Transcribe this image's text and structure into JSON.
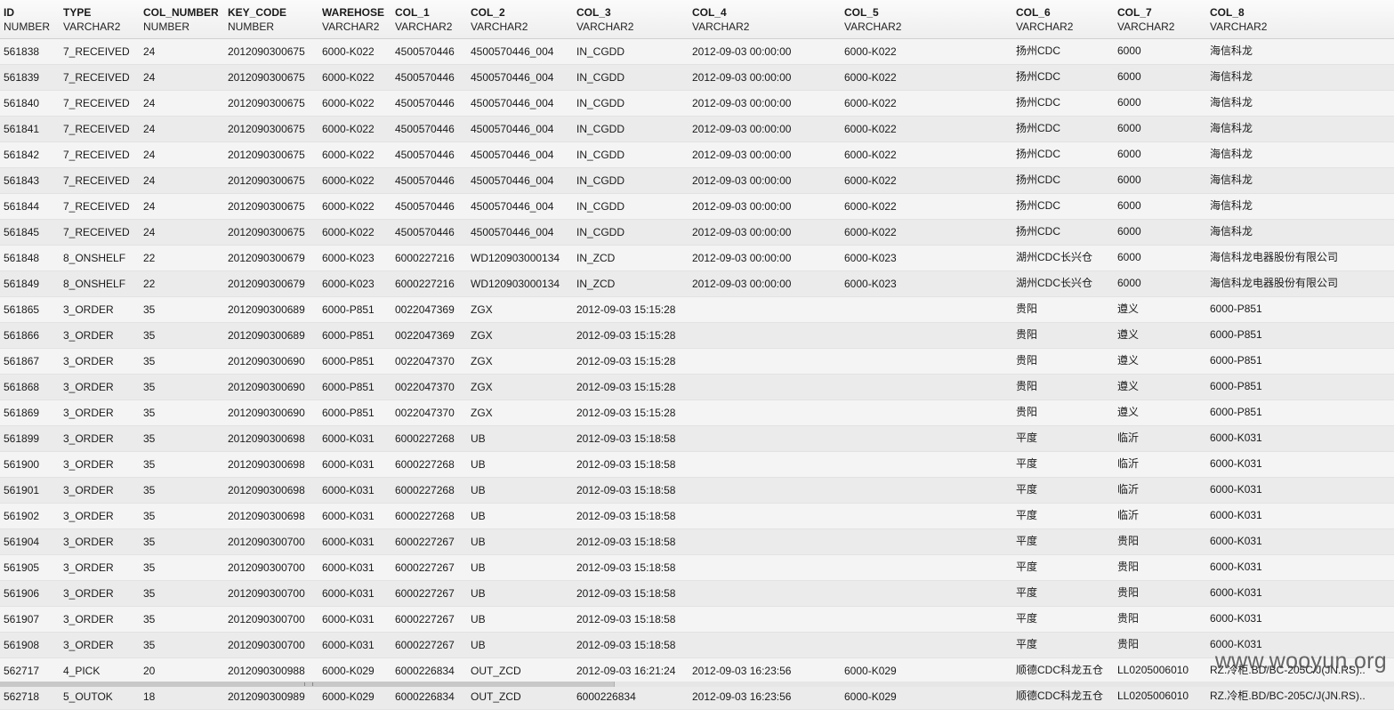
{
  "columns": [
    {
      "name": "ID",
      "type": "NUMBER"
    },
    {
      "name": "TYPE",
      "type": "VARCHAR2"
    },
    {
      "name": "COL_NUMBER",
      "type": "NUMBER"
    },
    {
      "name": "KEY_CODE",
      "type": "NUMBER"
    },
    {
      "name": "WAREHOSE",
      "type": "VARCHAR2"
    },
    {
      "name": "COL_1",
      "type": "VARCHAR2"
    },
    {
      "name": "COL_2",
      "type": "VARCHAR2"
    },
    {
      "name": "COL_3",
      "type": "VARCHAR2"
    },
    {
      "name": "COL_4",
      "type": "VARCHAR2"
    },
    {
      "name": "COL_5",
      "type": "VARCHAR2"
    },
    {
      "name": "COL_6",
      "type": "VARCHAR2"
    },
    {
      "name": "COL_7",
      "type": "VARCHAR2"
    },
    {
      "name": "COL_8",
      "type": "VARCHAR2"
    }
  ],
  "rows": [
    [
      "561838",
      "7_RECEIVED",
      "24",
      "2012090300675",
      "6000-K022",
      "4500570446",
      "4500570446_004",
      "IN_CGDD",
      "2012-09-03 00:00:00",
      "6000-K022",
      "扬州CDC",
      "6000",
      "海信科龙"
    ],
    [
      "561839",
      "7_RECEIVED",
      "24",
      "2012090300675",
      "6000-K022",
      "4500570446",
      "4500570446_004",
      "IN_CGDD",
      "2012-09-03 00:00:00",
      "6000-K022",
      "扬州CDC",
      "6000",
      "海信科龙"
    ],
    [
      "561840",
      "7_RECEIVED",
      "24",
      "2012090300675",
      "6000-K022",
      "4500570446",
      "4500570446_004",
      "IN_CGDD",
      "2012-09-03 00:00:00",
      "6000-K022",
      "扬州CDC",
      "6000",
      "海信科龙"
    ],
    [
      "561841",
      "7_RECEIVED",
      "24",
      "2012090300675",
      "6000-K022",
      "4500570446",
      "4500570446_004",
      "IN_CGDD",
      "2012-09-03 00:00:00",
      "6000-K022",
      "扬州CDC",
      "6000",
      "海信科龙"
    ],
    [
      "561842",
      "7_RECEIVED",
      "24",
      "2012090300675",
      "6000-K022",
      "4500570446",
      "4500570446_004",
      "IN_CGDD",
      "2012-09-03 00:00:00",
      "6000-K022",
      "扬州CDC",
      "6000",
      "海信科龙"
    ],
    [
      "561843",
      "7_RECEIVED",
      "24",
      "2012090300675",
      "6000-K022",
      "4500570446",
      "4500570446_004",
      "IN_CGDD",
      "2012-09-03 00:00:00",
      "6000-K022",
      "扬州CDC",
      "6000",
      "海信科龙"
    ],
    [
      "561844",
      "7_RECEIVED",
      "24",
      "2012090300675",
      "6000-K022",
      "4500570446",
      "4500570446_004",
      "IN_CGDD",
      "2012-09-03 00:00:00",
      "6000-K022",
      "扬州CDC",
      "6000",
      "海信科龙"
    ],
    [
      "561845",
      "7_RECEIVED",
      "24",
      "2012090300675",
      "6000-K022",
      "4500570446",
      "4500570446_004",
      "IN_CGDD",
      "2012-09-03 00:00:00",
      "6000-K022",
      "扬州CDC",
      "6000",
      "海信科龙"
    ],
    [
      "561848",
      "8_ONSHELF",
      "22",
      "2012090300679",
      "6000-K023",
      "6000227216",
      "WD120903000134",
      "IN_ZCD",
      "2012-09-03 00:00:00",
      "6000-K023",
      "湖州CDC长兴仓",
      "6000",
      "海信科龙电器股份有限公司"
    ],
    [
      "561849",
      "8_ONSHELF",
      "22",
      "2012090300679",
      "6000-K023",
      "6000227216",
      "WD120903000134",
      "IN_ZCD",
      "2012-09-03 00:00:00",
      "6000-K023",
      "湖州CDC长兴仓",
      "6000",
      "海信科龙电器股份有限公司"
    ],
    [
      "561865",
      "3_ORDER",
      "35",
      "2012090300689",
      "6000-P851",
      "0022047369",
      "ZGX",
      "2012-09-03 15:15:28",
      "",
      "",
      "贵阳",
      "遵义",
      "6000-P851"
    ],
    [
      "561866",
      "3_ORDER",
      "35",
      "2012090300689",
      "6000-P851",
      "0022047369",
      "ZGX",
      "2012-09-03 15:15:28",
      "",
      "",
      "贵阳",
      "遵义",
      "6000-P851"
    ],
    [
      "561867",
      "3_ORDER",
      "35",
      "2012090300690",
      "6000-P851",
      "0022047370",
      "ZGX",
      "2012-09-03 15:15:28",
      "",
      "",
      "贵阳",
      "遵义",
      "6000-P851"
    ],
    [
      "561868",
      "3_ORDER",
      "35",
      "2012090300690",
      "6000-P851",
      "0022047370",
      "ZGX",
      "2012-09-03 15:15:28",
      "",
      "",
      "贵阳",
      "遵义",
      "6000-P851"
    ],
    [
      "561869",
      "3_ORDER",
      "35",
      "2012090300690",
      "6000-P851",
      "0022047370",
      "ZGX",
      "2012-09-03 15:15:28",
      "",
      "",
      "贵阳",
      "遵义",
      "6000-P851"
    ],
    [
      "561899",
      "3_ORDER",
      "35",
      "2012090300698",
      "6000-K031",
      "6000227268",
      "UB",
      "2012-09-03 15:18:58",
      "",
      "",
      "平度",
      "临沂",
      "6000-K031"
    ],
    [
      "561900",
      "3_ORDER",
      "35",
      "2012090300698",
      "6000-K031",
      "6000227268",
      "UB",
      "2012-09-03 15:18:58",
      "",
      "",
      "平度",
      "临沂",
      "6000-K031"
    ],
    [
      "561901",
      "3_ORDER",
      "35",
      "2012090300698",
      "6000-K031",
      "6000227268",
      "UB",
      "2012-09-03 15:18:58",
      "",
      "",
      "平度",
      "临沂",
      "6000-K031"
    ],
    [
      "561902",
      "3_ORDER",
      "35",
      "2012090300698",
      "6000-K031",
      "6000227268",
      "UB",
      "2012-09-03 15:18:58",
      "",
      "",
      "平度",
      "临沂",
      "6000-K031"
    ],
    [
      "561904",
      "3_ORDER",
      "35",
      "2012090300700",
      "6000-K031",
      "6000227267",
      "UB",
      "2012-09-03 15:18:58",
      "",
      "",
      "平度",
      "贵阳",
      "6000-K031"
    ],
    [
      "561905",
      "3_ORDER",
      "35",
      "2012090300700",
      "6000-K031",
      "6000227267",
      "UB",
      "2012-09-03 15:18:58",
      "",
      "",
      "平度",
      "贵阳",
      "6000-K031"
    ],
    [
      "561906",
      "3_ORDER",
      "35",
      "2012090300700",
      "6000-K031",
      "6000227267",
      "UB",
      "2012-09-03 15:18:58",
      "",
      "",
      "平度",
      "贵阳",
      "6000-K031"
    ],
    [
      "561907",
      "3_ORDER",
      "35",
      "2012090300700",
      "6000-K031",
      "6000227267",
      "UB",
      "2012-09-03 15:18:58",
      "",
      "",
      "平度",
      "贵阳",
      "6000-K031"
    ],
    [
      "561908",
      "3_ORDER",
      "35",
      "2012090300700",
      "6000-K031",
      "6000227267",
      "UB",
      "2012-09-03 15:18:58",
      "",
      "",
      "平度",
      "贵阳",
      "6000-K031"
    ],
    [
      "562717",
      "4_PICK",
      "20",
      "2012090300988",
      "6000-K029",
      "6000226834",
      "OUT_ZCD",
      "2012-09-03 16:21:24",
      "2012-09-03 16:23:56",
      "6000-K029",
      "顺德CDC科龙五仓",
      "LL0205006010",
      "RZ.冷柜.BD/BC-205C/J(JN.RS).."
    ],
    [
      "562718",
      "5_OUTOK",
      "18",
      "2012090300989",
      "6000-K029",
      "6000226834",
      "OUT_ZCD",
      "6000226834",
      "2012-09-03 16:23:56",
      "6000-K029",
      "顺德CDC科龙五仓",
      "LL0205006010",
      "RZ.冷柜.BD/BC-205C/J(JN.RS).."
    ]
  ],
  "watermark": "www.wooyun.org"
}
